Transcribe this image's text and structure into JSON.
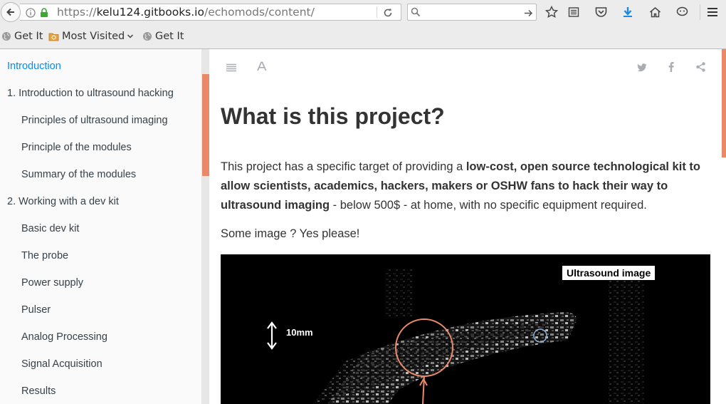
{
  "browser": {
    "url_prefix": "https://",
    "url_host": "kelu124.gitbooks.io",
    "url_path": "/echomods/content/",
    "search_value": ""
  },
  "bookmarks": [
    {
      "label": "Get It",
      "icon": "globe-icon"
    },
    {
      "label": "Most Visited",
      "icon": "folder-icon"
    },
    {
      "label": "Get It",
      "icon": "globe-icon"
    }
  ],
  "sidebar": {
    "items": [
      {
        "label": "Introduction",
        "active": true
      },
      {
        "label": "1. Introduction to ultrasound hacking"
      },
      {
        "label": "Principles of ultrasound imaging"
      },
      {
        "label": "Principle of the modules"
      },
      {
        "label": "Summary of the modules"
      },
      {
        "label": "2. Working with a dev kit"
      },
      {
        "label": "Basic dev kit"
      },
      {
        "label": "The probe"
      },
      {
        "label": "Power supply"
      },
      {
        "label": "Pulser"
      },
      {
        "label": "Analog Processing"
      },
      {
        "label": "Signal Acquisition"
      },
      {
        "label": "Results"
      }
    ]
  },
  "page": {
    "title": "What is this project?",
    "p1": {
      "a": "This project has a specific target of providing a ",
      "b": "low-cost, open source technological kit to allow scientists, academics, hackers, makers or OSHW fans to hack their way to ultrasound imaging",
      "c": " - below 500$ - at home, with no specific equipment required."
    },
    "p2": "Some image ? Yes please!",
    "figure": {
      "label": "Ultrasound image",
      "scale": "10mm"
    }
  },
  "colors": {
    "accent": "#e9896a",
    "link": "#008cff",
    "text": "#333333"
  }
}
